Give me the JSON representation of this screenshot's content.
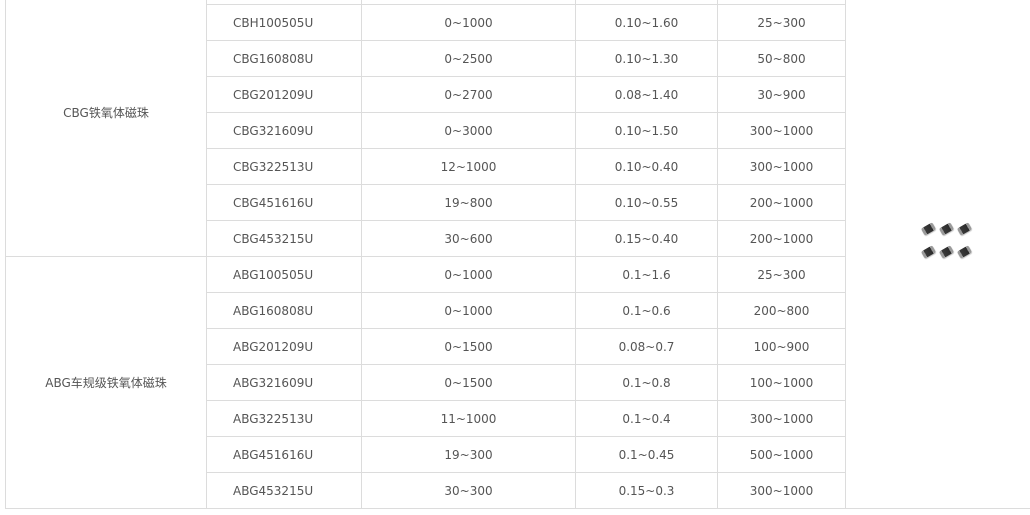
{
  "groups": [
    {
      "name": "CBG铁氧体磁珠",
      "rows": [
        {
          "part": "",
          "impedance": "",
          "dcr": "",
          "current": ""
        },
        {
          "part": "CBH100505U",
          "impedance": "0~1000",
          "dcr": "0.10~1.60",
          "current": "25~300"
        },
        {
          "part": "CBG160808U",
          "impedance": "0~2500",
          "dcr": "0.10~1.30",
          "current": "50~800"
        },
        {
          "part": "CBG201209U",
          "impedance": "0~2700",
          "dcr": "0.08~1.40",
          "current": "30~900"
        },
        {
          "part": "CBG321609U",
          "impedance": "0~3000",
          "dcr": "0.10~1.50",
          "current": "300~1000"
        },
        {
          "part": "CBG322513U",
          "impedance": "12~1000",
          "dcr": "0.10~0.40",
          "current": "300~1000"
        },
        {
          "part": "CBG451616U",
          "impedance": "19~800",
          "dcr": "0.10~0.55",
          "current": "200~1000"
        },
        {
          "part": "CBG453215U",
          "impedance": "30~600",
          "dcr": "0.15~0.40",
          "current": "200~1000"
        }
      ]
    },
    {
      "name": "ABG车规级铁氧体磁珠",
      "rows": [
        {
          "part": "ABG100505U",
          "impedance": "0~1000",
          "dcr": "0.1~1.6",
          "current": "25~300"
        },
        {
          "part": "ABG160808U",
          "impedance": "0~1000",
          "dcr": "0.1~0.6",
          "current": "200~800"
        },
        {
          "part": "ABG201209U",
          "impedance": "0~1500",
          "dcr": "0.08~0.7",
          "current": "100~900"
        },
        {
          "part": "ABG321609U",
          "impedance": "0~1500",
          "dcr": "0.1~0.8",
          "current": "100~1000"
        },
        {
          "part": "ABG322513U",
          "impedance": "11~1000",
          "dcr": "0.1~0.4",
          "current": "300~1000"
        },
        {
          "part": "ABG451616U",
          "impedance": "19~300",
          "dcr": "0.1~0.45",
          "current": "500~1000"
        },
        {
          "part": "ABG453215U",
          "impedance": "30~300",
          "dcr": "0.15~0.3",
          "current": "300~1000"
        }
      ]
    }
  ],
  "product_image": {
    "icon": "ferrite-bead-chips-icon",
    "bead_count": 6
  }
}
